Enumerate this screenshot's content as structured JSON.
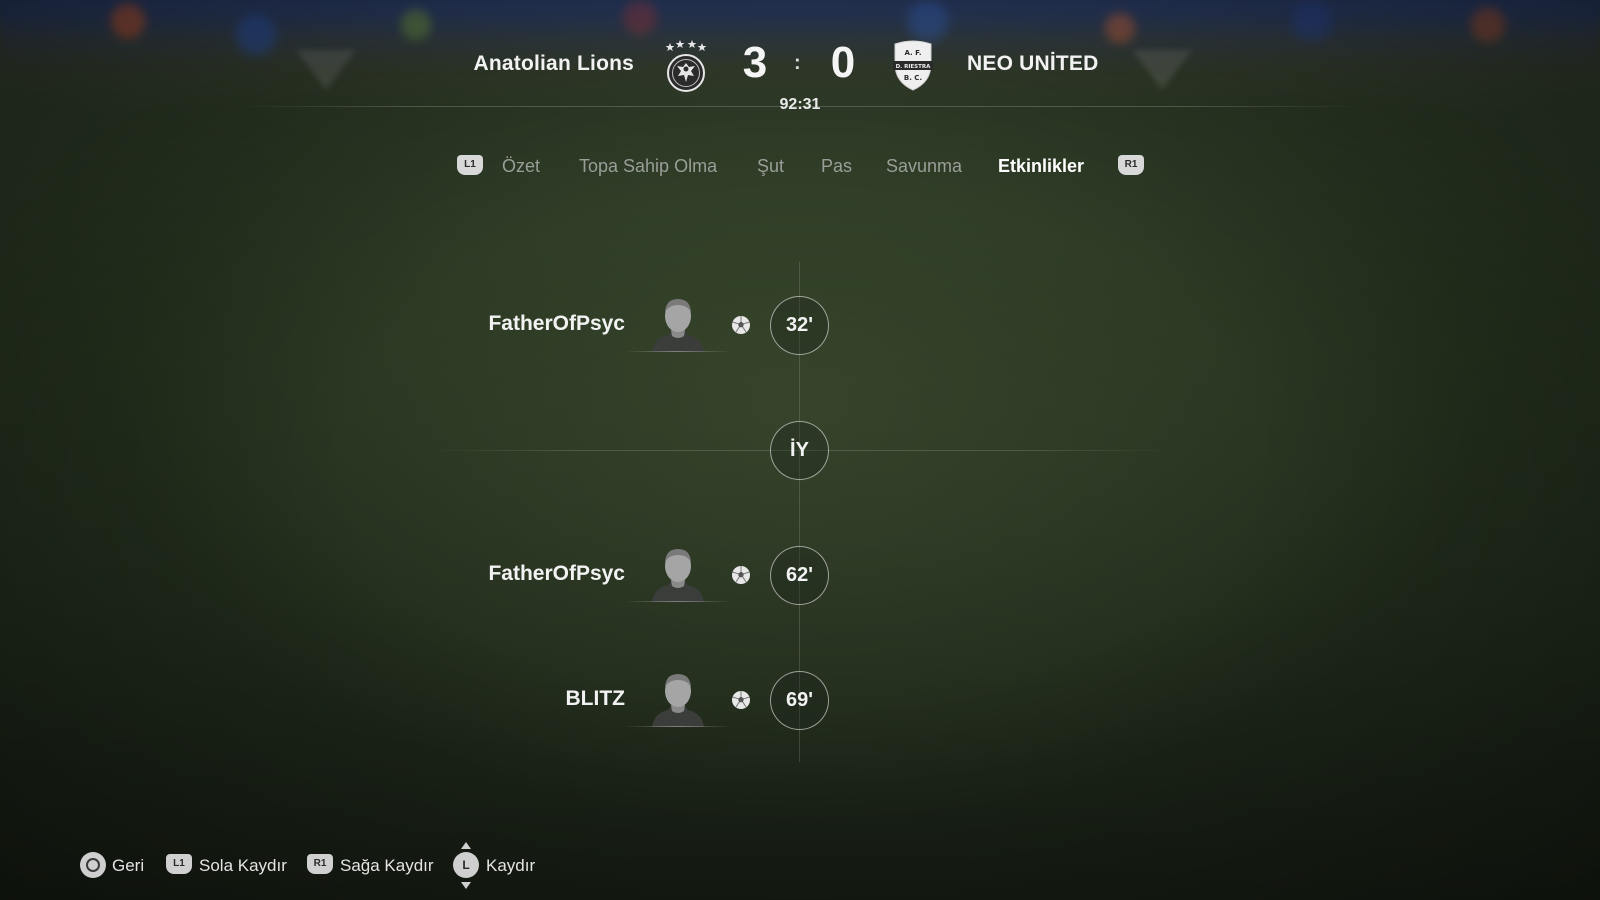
{
  "header": {
    "home_team": "Anatolian Lions",
    "away_team": "NEO UNİTED",
    "home_score": "3",
    "away_score": "0",
    "separator": ":",
    "clock": "92:31",
    "away_crest_text_top": "A.  F.",
    "away_crest_text_mid": "D. RIESTRA",
    "away_crest_text_bot": "B.  C."
  },
  "tabs": {
    "left_button": "L1",
    "right_button": "R1",
    "items": [
      {
        "label": "Özet",
        "active": false
      },
      {
        "label": "Topa Sahip Olma",
        "active": false
      },
      {
        "label": "Şut",
        "active": false
      },
      {
        "label": "Pas",
        "active": false
      },
      {
        "label": "Savunma",
        "active": false
      },
      {
        "label": "Etkinlikler",
        "active": true
      }
    ]
  },
  "timeline": {
    "events": [
      {
        "player": "FatherOfPsyc",
        "minute": "32'",
        "type": "goal",
        "icon": "soccer-ball-icon"
      },
      {
        "player": "FatherOfPsyc",
        "minute": "62'",
        "type": "goal",
        "icon": "soccer-ball-icon"
      },
      {
        "player": "BLITZ",
        "minute": "69'",
        "type": "goal",
        "icon": "soccer-ball-icon"
      }
    ],
    "halftime_label": "İY"
  },
  "footer": {
    "back": {
      "button": "circle",
      "label": "Geri"
    },
    "scroll_left": {
      "button": "L1",
      "label": "Sola Kaydır"
    },
    "scroll_right": {
      "button": "R1",
      "label": "Sağa Kaydır"
    },
    "scroll": {
      "button": "L",
      "label": "Kaydır"
    }
  },
  "colors": {
    "active_tab": "#ffffff",
    "inactive_tab": "#9a9e98",
    "pitch": "#26331f"
  }
}
